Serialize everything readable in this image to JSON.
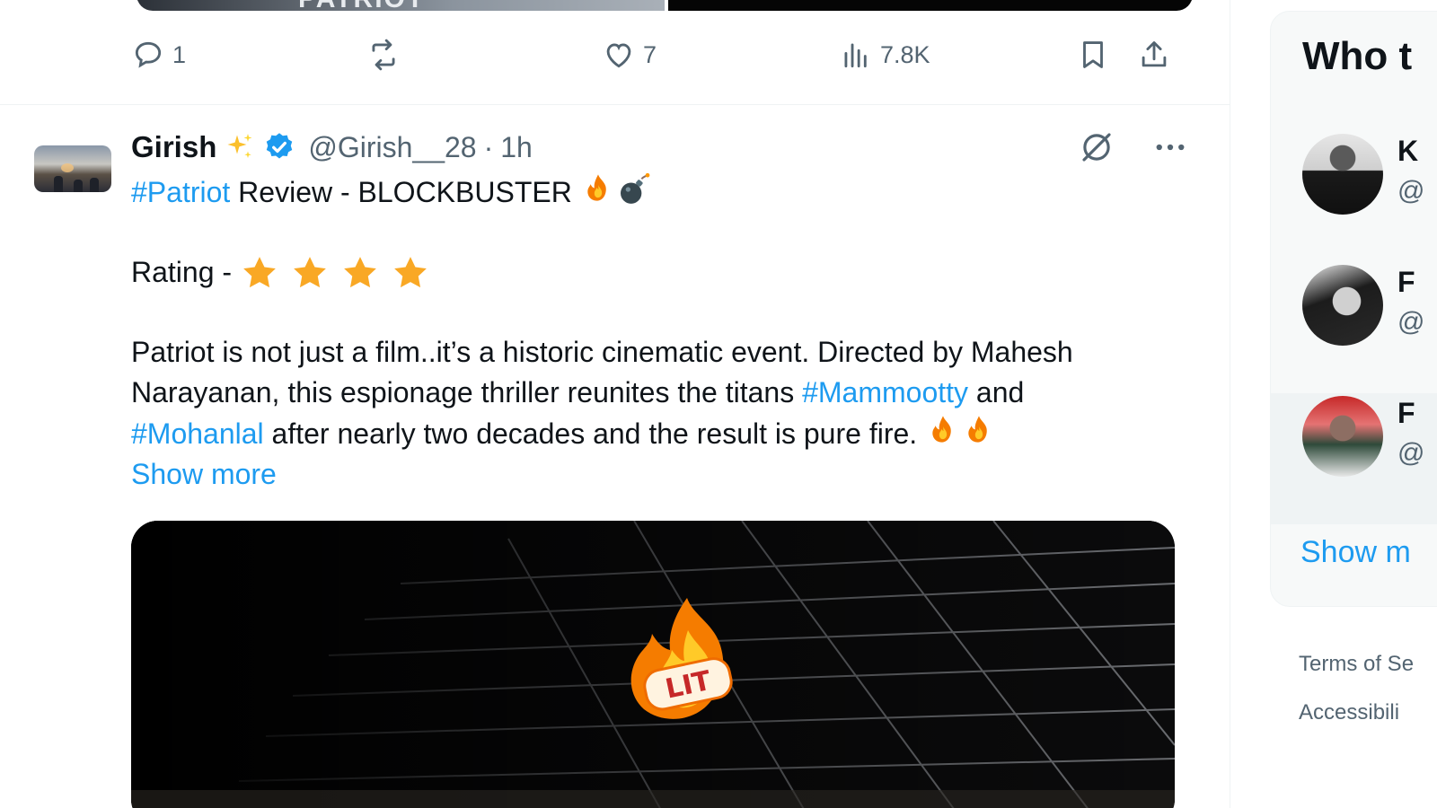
{
  "previous_post": {
    "media_text": "PATRIOT",
    "actions": {
      "replies": "1",
      "reposts": "",
      "likes": "7",
      "views": "7.8K"
    }
  },
  "post": {
    "author_name": "Girish",
    "author_handle": "@Girish__28",
    "separator": "·",
    "time": "1h",
    "line1": {
      "hashtag": "#Patriot",
      "text": " Review - BLOCKBUSTER "
    },
    "rating_label": "Rating - ",
    "rating_stars": 4,
    "body": {
      "part1": "Patriot is not just a film..it’s a historic cinematic event. Directed by Mahesh Narayanan, this espionage thriller reunites the titans ",
      "hashtag1": "#Mammootty",
      "part2": " and ",
      "hashtag2": "#Mohanlal",
      "part3": " after nearly two decades and the result is pure fire. "
    },
    "show_more": "Show more",
    "media_sticker_text": "LIT"
  },
  "sidebar": {
    "title": "Who t",
    "items": [
      {
        "name": "K",
        "handle": "@"
      },
      {
        "name": "F",
        "handle": "@"
      },
      {
        "name": "F",
        "handle": "@"
      }
    ],
    "show_more": "Show m",
    "footer": [
      "Terms of Se",
      "Accessibili"
    ]
  },
  "colors": {
    "accent": "#1d9bf0",
    "secondary_text": "#536471",
    "star": "#f9a825"
  }
}
